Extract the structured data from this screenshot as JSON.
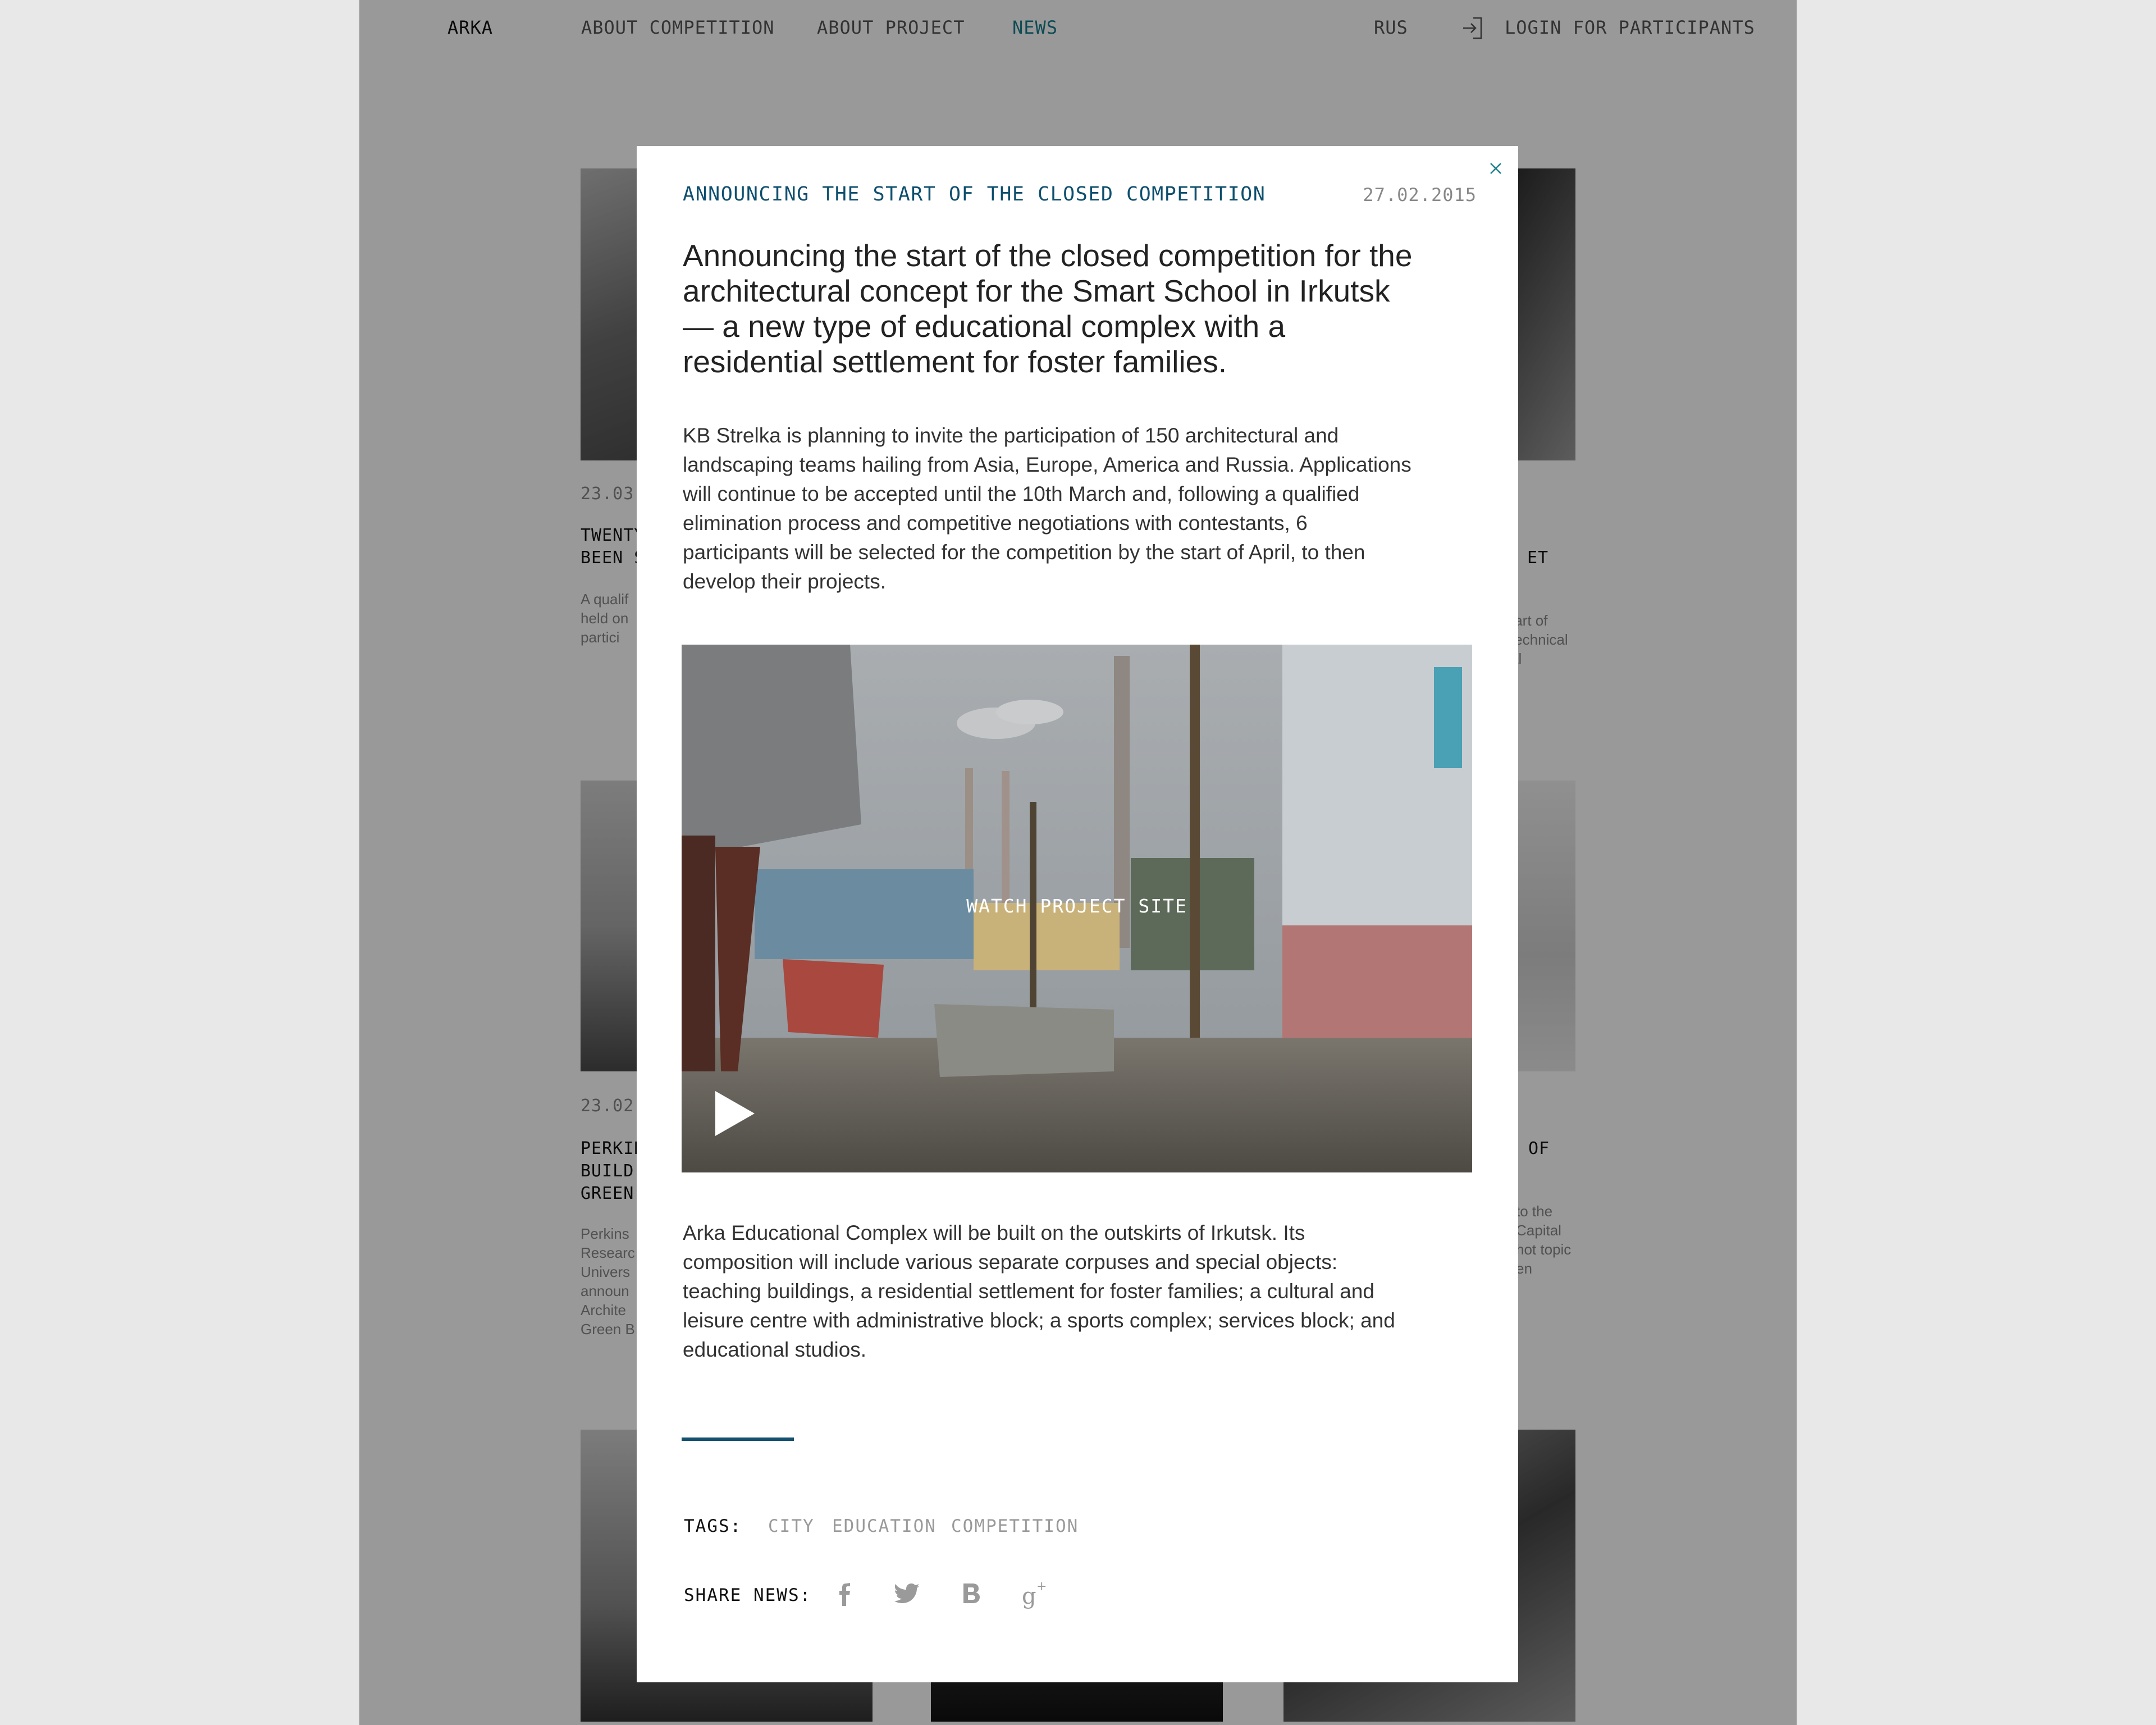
{
  "nav": {
    "logo": "ARKA",
    "items": [
      "ABOUT COMPETITION",
      "ABOUT PROJECT",
      "NEWS"
    ],
    "language": "RUS",
    "login": "LOGIN FOR PARTICIPANTS"
  },
  "background_cards": [
    {
      "date": "23.03",
      "title": "TWENTY\nBEEN S",
      "desc": "A qualif\nheld on\npartici"
    },
    {
      "date": "",
      "title": "ET",
      "desc": "tart of\ntechnical\nal"
    },
    {
      "date": "23.02",
      "title": "PERKIN\nBUILD\nGREEN",
      "desc": "Perkins\nResearc\nUnivers\nannoun\nArchite\nGreen B"
    },
    {
      "date": "",
      "title": "OF",
      "desc": "to the\nCapital\nhot topic\nen"
    }
  ],
  "modal": {
    "kicker": "ANNOUNCING THE START OF THE CLOSED COMPETITION",
    "date": "27.02.2015",
    "headline": "Announcing the start of the closed competition for the architectural concept for the Smart School in Irkutsk — a new type of educational complex with a residential settlement for foster families.",
    "paragraph1": "KB Strelka is planning to invite the participation of 150 architectural and landscaping teams hailing from Asia, Europe, America and Russia. Applications will continue to be accepted until the 10th March and, following a qualified elimination process and competitive negotiations with contestants, 6 participants will be selected for the competition by the start of April, to then develop their projects.",
    "video_label": "WATCH PROJECT SITE",
    "paragraph2": "Arka Educational Complex will be built on the outskirts of Irkutsk. Its composition will include various separate corpuses and special objects: teaching buildings, a residential settlement for foster families; a cultural and leisure centre with administrative block; a sports complex; services block; and educational studios.",
    "tags_label": "TAGS:",
    "tags": [
      "CITY",
      "EDUCATION",
      "COMPETITION"
    ],
    "share_label": "SHARE NEWS:",
    "share_icons": [
      "facebook-icon",
      "twitter-icon",
      "vk-icon",
      "google-plus-icon"
    ]
  },
  "colors": {
    "accent": "#1a7f8c",
    "kicker": "#0e4f6e",
    "overlay": "rgba(0,0,0,0.40)"
  }
}
